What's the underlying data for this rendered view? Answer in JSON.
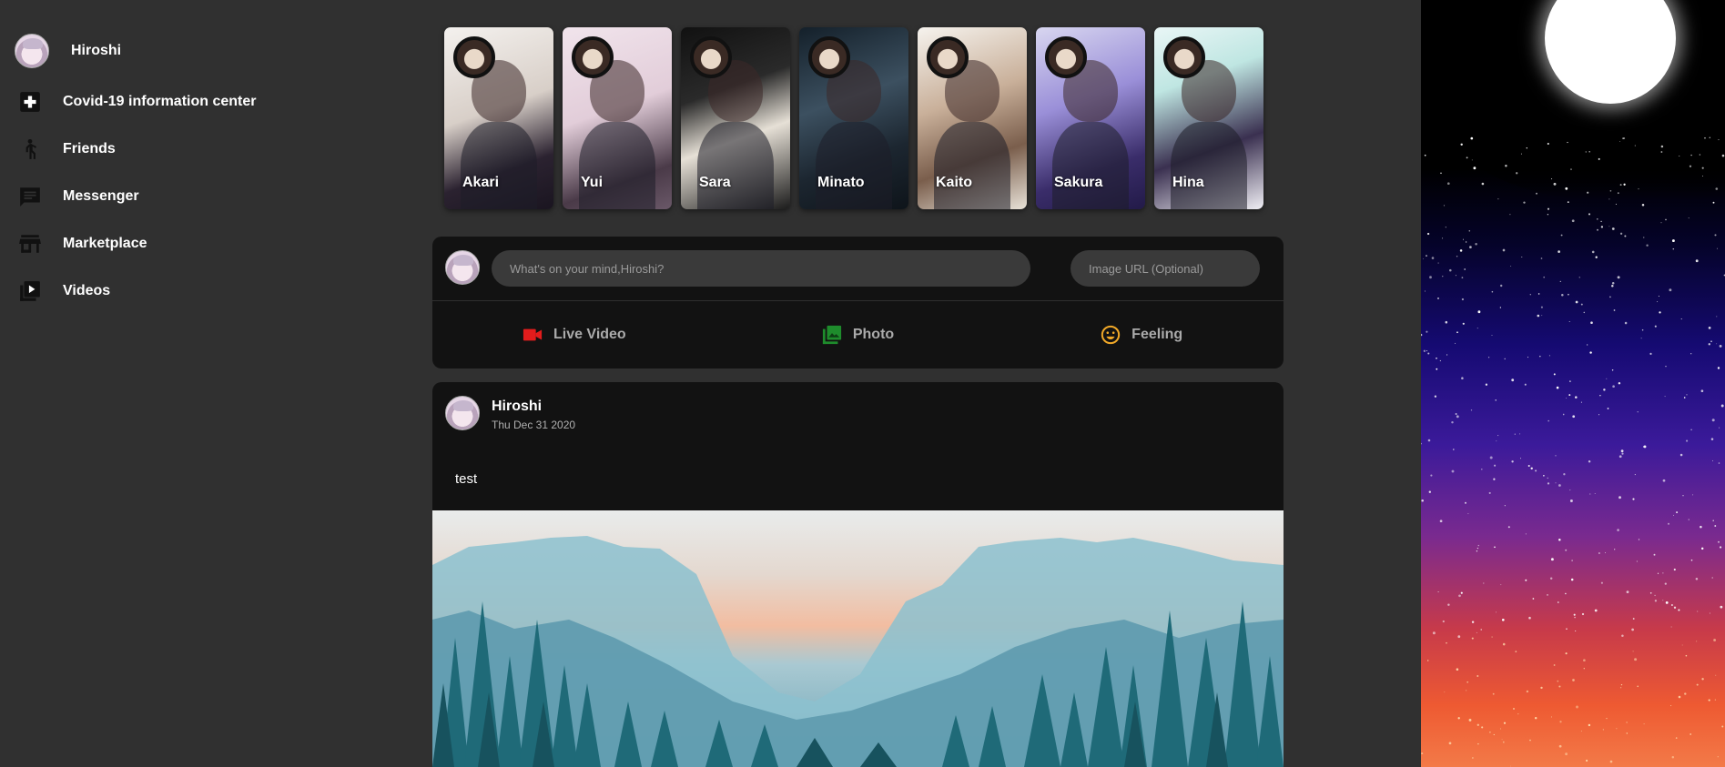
{
  "user": {
    "name": "Hiroshi"
  },
  "sidebar": {
    "items": [
      {
        "label": "Covid-19 information center",
        "icon": "plus-box-icon"
      },
      {
        "label": "Friends",
        "icon": "person-walking-icon"
      },
      {
        "label": "Messenger",
        "icon": "chat-bubble-icon"
      },
      {
        "label": "Marketplace",
        "icon": "store-icon"
      },
      {
        "label": "Videos",
        "icon": "video-library-icon"
      }
    ]
  },
  "stories": [
    {
      "name": "Akari",
      "colors": [
        "#f4f1ee",
        "#2b2230"
      ]
    },
    {
      "name": "Yui",
      "colors": [
        "#ead8e4",
        "#4a3a48"
      ]
    },
    {
      "name": "Sara",
      "colors": [
        "#1c1c1c",
        "#d9d2c8"
      ]
    },
    {
      "name": "Minato",
      "colors": [
        "#1c2630",
        "#5a6a78"
      ]
    },
    {
      "name": "Kaito",
      "colors": [
        "#f3efe8",
        "#7a5e4c"
      ]
    },
    {
      "name": "Sakura",
      "colors": [
        "#c7c3e8",
        "#3a2d6a"
      ]
    },
    {
      "name": "Hina",
      "colors": [
        "#e9f2f6",
        "#3a3050"
      ]
    }
  ],
  "composer": {
    "text_placeholder": "What's on your mind,Hiroshi?",
    "url_placeholder": "Image URL (Optional)",
    "actions": [
      {
        "label": "Live Video",
        "icon": "video-camera-icon",
        "color": "#e31c1c"
      },
      {
        "label": "Photo",
        "icon": "photo-library-icon",
        "color": "#1e8c2c"
      },
      {
        "label": "Feeling",
        "icon": "smiley-icon",
        "color": "#f0a828"
      }
    ]
  },
  "post": {
    "author": "Hiroshi",
    "date": "Thu Dec 31 2020",
    "text": "test"
  },
  "colors": {
    "page_bg": "#303030",
    "card_bg": "#121212",
    "input_bg": "#3a3a3a"
  }
}
